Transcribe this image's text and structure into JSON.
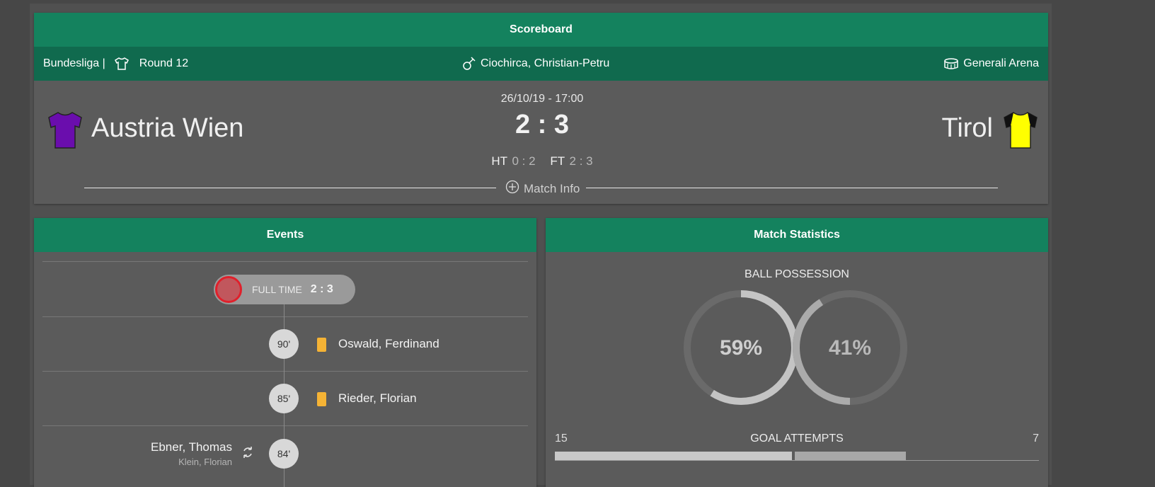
{
  "scoreboard": {
    "title": "Scoreboard",
    "league": "Bundesliga |",
    "round": "Round 12",
    "referee": "Ciochirca, Christian-Petru",
    "venue": "Generali Arena",
    "datetime": "26/10/19 - 17:00",
    "score": "2 : 3",
    "ht_label": "HT",
    "ht_score": "0 : 2",
    "ft_label": "FT",
    "ft_score": "2 : 3",
    "match_info": "Match Info",
    "home": {
      "name": "Austria Wien",
      "shirt_color": "#6a0dad"
    },
    "away": {
      "name": "Tirol",
      "shirt_color": "#ffff00"
    }
  },
  "events": {
    "title": "Events",
    "full_time": {
      "label": "FULL TIME",
      "score": "2 : 3"
    },
    "items": [
      {
        "minute": "90'",
        "type": "yellow-card",
        "player": "Oswald, Ferdinand"
      },
      {
        "minute": "85'",
        "type": "yellow-card",
        "player": "Rieder, Florian"
      },
      {
        "minute": "84'",
        "type": "substitution",
        "player_in": "Ebner, Thomas",
        "player_out": "Klein, Florian"
      }
    ]
  },
  "stats": {
    "title": "Match Statistics",
    "possession": {
      "label": "BALL POSSESSION",
      "home": "59%",
      "away": "41%",
      "home_value": 59,
      "away_value": 41
    },
    "goal_attempts": {
      "label": "GOAL ATTEMPTS",
      "home": "15",
      "away": "7",
      "home_value": 15,
      "away_value": 7
    }
  },
  "colors": {
    "header": "#14825e",
    "subheader": "#106a4e",
    "yellow_card": "#f5b335",
    "full_time_dot": "#e0202b"
  }
}
